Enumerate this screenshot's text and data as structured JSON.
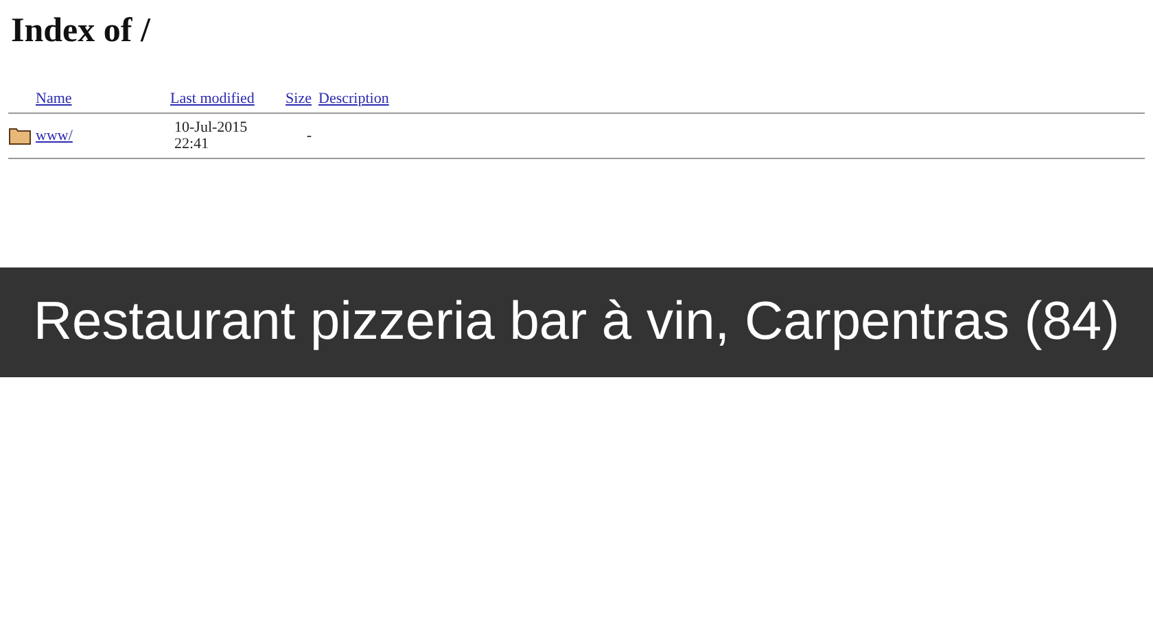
{
  "title": "Index of /",
  "columns": [
    "Name",
    "Last modified",
    "Size",
    "Description"
  ],
  "rows": [
    {
      "kind": "folder",
      "name": "www/",
      "modified": "10-Jul-2015 22:41",
      "size": "-"
    }
  ],
  "banner": "Restaurant pizzeria bar à vin, Carpentras (84)"
}
